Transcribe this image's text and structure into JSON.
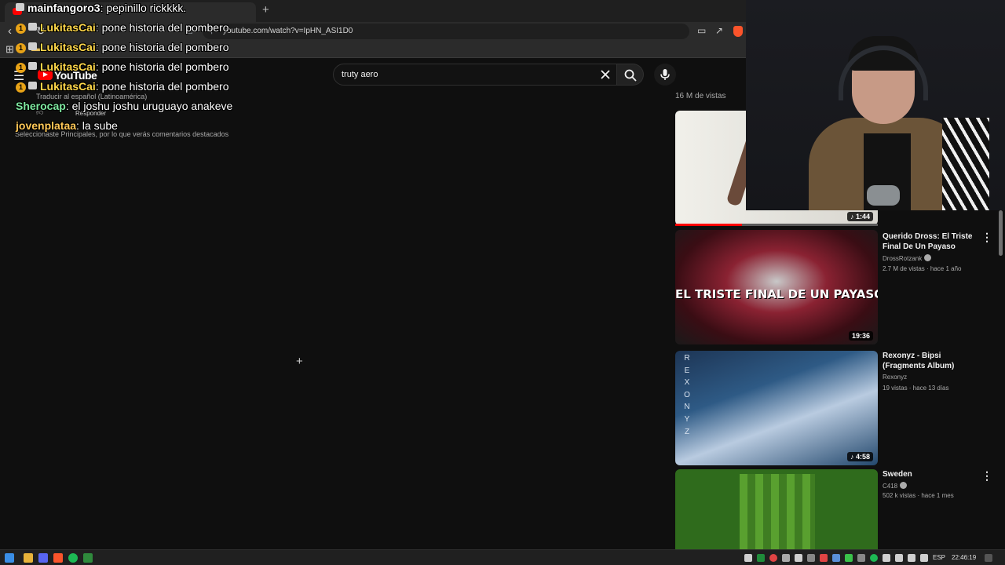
{
  "browser": {
    "address": "youtube.com/watch?v=IpHN_ASI1D0",
    "new_tab": "+"
  },
  "header": {
    "logo_text": "YouTube",
    "search_value": "truty aero"
  },
  "comments": {
    "translate": "Traducir al español (Latinoamérica)",
    "reply": "Responder",
    "note": "Seleccionaste Principales, por lo que verás comentarios destacados"
  },
  "chat": [
    {
      "user": "mainfangoro3",
      "message": "pepinillo rickkkk.",
      "color": "#ffffff",
      "badges": 1
    },
    {
      "user": "LukitasCai",
      "message": "pone historia del pombero",
      "color": "#ffd84a",
      "badges": 2
    },
    {
      "user": "LukitasCai",
      "message": "pone historia del pombero",
      "color": "#ffd84a",
      "badges": 2
    },
    {
      "user": "LukitasCai",
      "message": "pone historia del pombero",
      "color": "#ffd84a",
      "badges": 2
    },
    {
      "user": "LukitasCai",
      "message": "pone historia del pombero",
      "color": "#ffd84a",
      "badges": 2
    },
    {
      "user": "Sherocap",
      "message": "el joshu joshu uruguayo anakeve",
      "color": "#7ee8a0",
      "badges": 0
    },
    {
      "user": "jovenplataa",
      "message": "la sube",
      "color": "#ffc857",
      "badges": 0
    }
  ],
  "sidebar": {
    "views_label": "16 M de vistas",
    "current_video": {
      "duration": "1:44",
      "progress": 0.33
    },
    "videos": [
      {
        "title": "Querido Dross: El Triste Final De Un Payaso",
        "channel": "DrossRotzank",
        "verified": true,
        "meta": "2.7 M de vistas · hace 1 año",
        "duration": "19:36",
        "thumb_text": "EL TRISTE FINAL DE UN PAYASO"
      },
      {
        "title": "Rexonyz - Bipsi (Fragments Album)",
        "channel": "Rexonyz",
        "verified": false,
        "meta": "19 vistas · hace 13 días",
        "duration": "4:58",
        "thumb_text": "REXONYZ"
      },
      {
        "title": "Sweden",
        "channel": "C418",
        "verified": true,
        "meta": "502 k vistas · hace 1 mes",
        "duration": "",
        "thumb_text": ""
      }
    ]
  },
  "taskbar": {
    "lang": "ESP",
    "clock": "22:46:19"
  },
  "icons": {
    "menu": "hamburger-icon",
    "search": "search-icon",
    "mic": "mic-icon",
    "clear": "close-icon",
    "kebab": "more-vert-icon",
    "music_note": "music-note-icon"
  },
  "colors": {
    "brand_red": "#ff0000",
    "background": "#0f0f0f"
  }
}
